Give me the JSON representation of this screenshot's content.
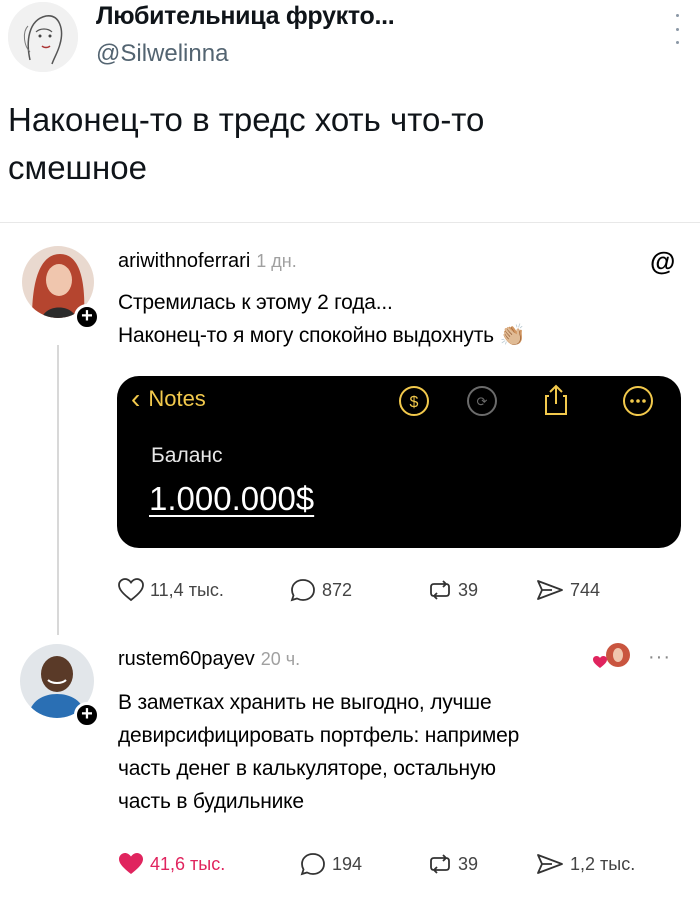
{
  "tweet": {
    "author_name": "Любительница фрукто...",
    "author_handle": "@Silwelinna",
    "text_line1": "Наконец-то в тредс хоть что-то",
    "text_line2": "смешное"
  },
  "card": {
    "post1": {
      "username": "ariwithnoferrari",
      "time": "1 дн.",
      "text_line1": "Стремилась к этому 2 года...",
      "text_line2": "Наконец-то я могу спокойно выдохнуть 👏🏼",
      "notes": {
        "back_label": "Notes",
        "label": "Баланс",
        "value": "1.000.000$"
      },
      "stats": {
        "likes": "11,4 тыс.",
        "comments": "872",
        "reposts": "39",
        "shares": "744"
      }
    },
    "post2": {
      "username": "rustem60payev",
      "time": "20 ч.",
      "text_line1": "В заметках хранить не выгодно, лучше",
      "text_line2": "девирсифицировать портфель: например",
      "text_line3": "часть денег в калькуляторе, остальную",
      "text_line4": "часть в будильнике",
      "stats": {
        "likes": "41,6 тыс.",
        "comments": "194",
        "reposts": "39",
        "shares": "1,2 тыс."
      }
    }
  },
  "colors": {
    "accent_like": "#e0245e",
    "notes_yellow": "#f2c94c"
  }
}
